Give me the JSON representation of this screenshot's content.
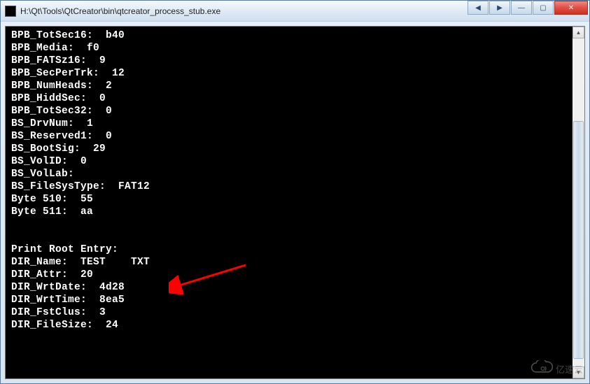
{
  "window": {
    "title": "H:\\Qt\\Tools\\QtCreator\\bin\\qtcreator_process_stub.exe"
  },
  "console": {
    "lines": [
      "BPB_TotSec16:  b40",
      "BPB_Media:  f0",
      "BPB_FATSz16:  9",
      "BPB_SecPerTrk:  12",
      "BPB_NumHeads:  2",
      "BPB_HiddSec:  0",
      "BPB_TotSec32:  0",
      "BS_DrvNum:  1",
      "BS_Reserved1:  0",
      "BS_BootSig:  29",
      "BS_VolID:  0",
      "BS_VolLab:",
      "BS_FileSysType:  FAT12",
      "Byte 510:  55",
      "Byte 511:  aa",
      "",
      "",
      "Print Root Entry:",
      "DIR_Name:  TEST    TXT",
      "DIR_Attr:  20",
      "DIR_WrtDate:  4d28",
      "DIR_WrtTime:  8ea5",
      "DIR_FstClus:  3",
      "DIR_FileSize:  24"
    ]
  },
  "controls": {
    "scroll_left": "◀",
    "scroll_right": "▶",
    "scroll_up": "▲",
    "scroll_down": "▼",
    "minimize": "—",
    "maximize": "▢",
    "close": "✕"
  },
  "watermark": {
    "text": "亿速云"
  }
}
